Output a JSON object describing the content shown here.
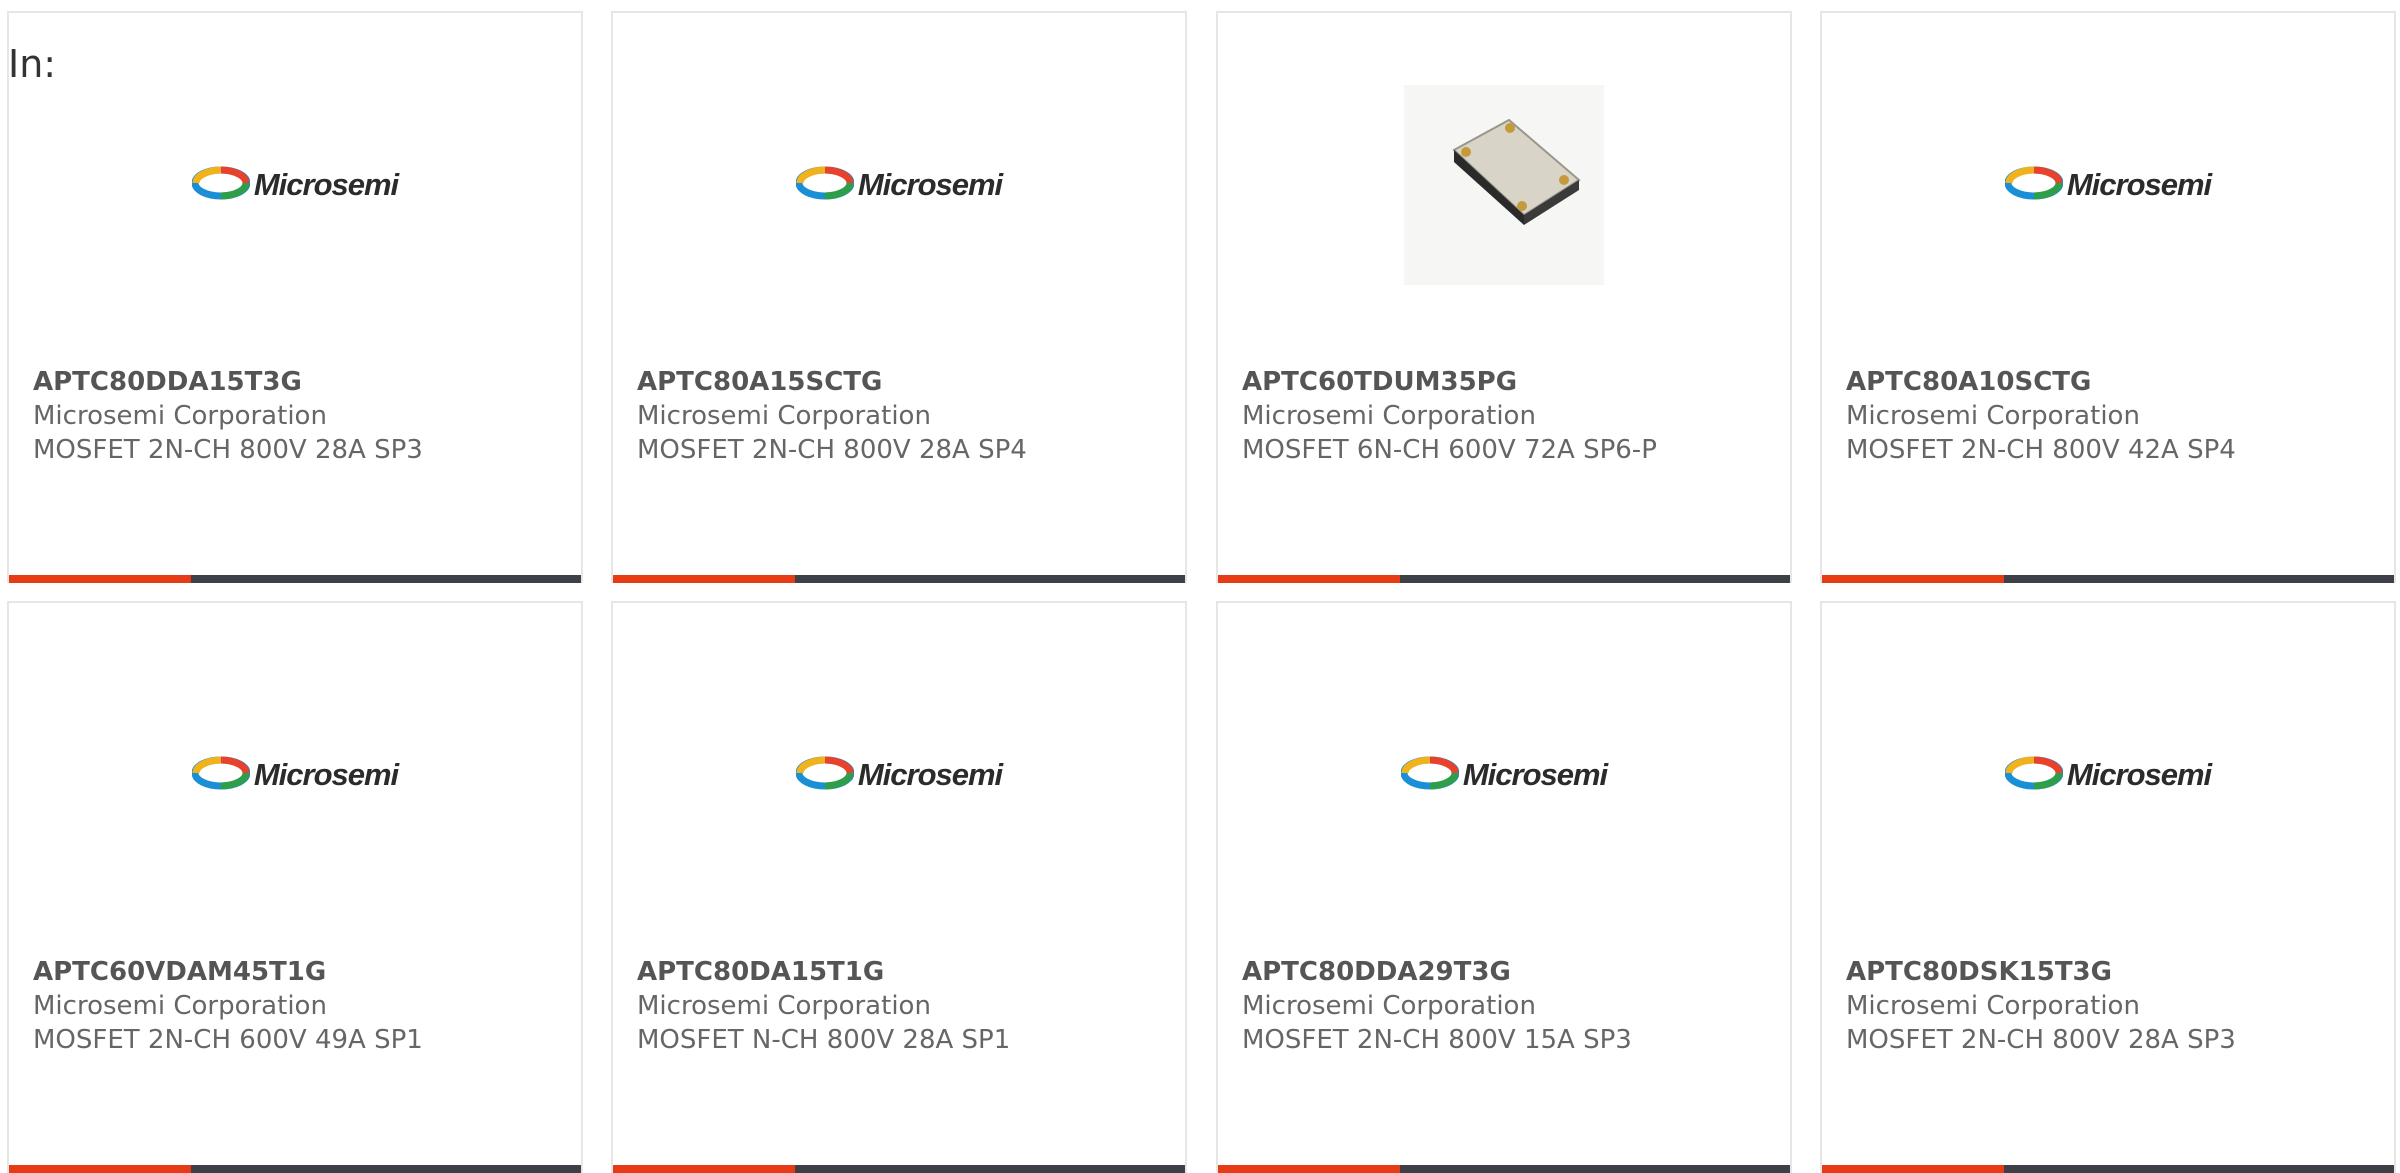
{
  "header": {
    "label": "In:"
  },
  "colors": {
    "accent": "#e63b14",
    "bar": "#3d4147"
  },
  "products": [
    {
      "part": "APTC80DDA15T3G",
      "manufacturer": "Microsemi Corporation",
      "description": "MOSFET 2N-CH 800V 28A SP3",
      "image": "microsemi-logo"
    },
    {
      "part": "APTC80A15SCTG",
      "manufacturer": "Microsemi Corporation",
      "description": "MOSFET 2N-CH 800V 28A SP4",
      "image": "microsemi-logo"
    },
    {
      "part": "APTC60TDUM35PG",
      "manufacturer": "Microsemi Corporation",
      "description": "MOSFET 6N-CH 600V 72A SP6-P",
      "image": "module-photo"
    },
    {
      "part": "APTC80A10SCTG",
      "manufacturer": "Microsemi Corporation",
      "description": "MOSFET 2N-CH 800V 42A SP4",
      "image": "microsemi-logo"
    },
    {
      "part": "APTC60VDAM45T1G",
      "manufacturer": "Microsemi Corporation",
      "description": "MOSFET 2N-CH 600V 49A SP1",
      "image": "microsemi-logo"
    },
    {
      "part": "APTC80DA15T1G",
      "manufacturer": "Microsemi Corporation",
      "description": "MOSFET N-CH 800V 28A SP1",
      "image": "microsemi-logo"
    },
    {
      "part": "APTC80DDA29T3G",
      "manufacturer": "Microsemi Corporation",
      "description": "MOSFET 2N-CH 800V 15A SP3",
      "image": "microsemi-logo"
    },
    {
      "part": "APTC80DSK15T3G",
      "manufacturer": "Microsemi Corporation",
      "description": "MOSFET 2N-CH 800V 28A SP3",
      "image": "microsemi-logo"
    }
  ],
  "logo_text": "Microsemi"
}
